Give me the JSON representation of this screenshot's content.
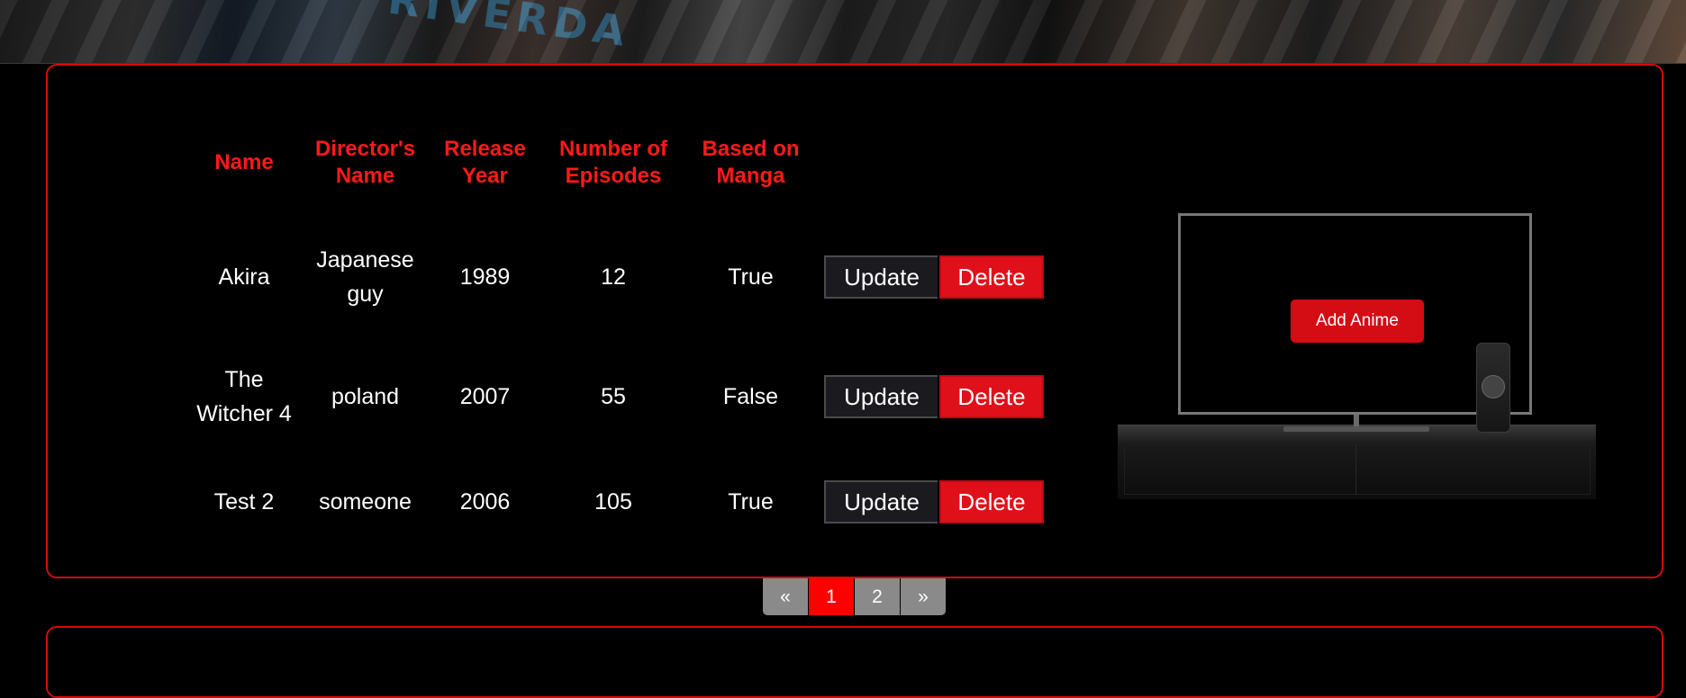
{
  "banner": {
    "word": "RIVERDA"
  },
  "table": {
    "headers": {
      "name": "Name",
      "director": "Director's Name",
      "year": "Release Year",
      "episodes": "Number of Episodes",
      "manga": "Based on Manga"
    },
    "rows": [
      {
        "name": "Akira",
        "director": "Japanese guy",
        "year": "1989",
        "episodes": "12",
        "manga": "True"
      },
      {
        "name": "The Witcher 4",
        "director": "poland",
        "year": "2007",
        "episodes": "55",
        "manga": "False"
      },
      {
        "name": "Test 2",
        "director": "someone",
        "year": "2006",
        "episodes": "105",
        "manga": "True"
      }
    ],
    "update_label": "Update",
    "delete_label": "Delete"
  },
  "add_button": "Add Anime",
  "pagination": {
    "prev": "«",
    "pages": [
      "1",
      "2"
    ],
    "next": "»",
    "active": "1"
  },
  "colors": {
    "accent": "#ff1a1a",
    "button_red": "#e0101a",
    "background": "#000000"
  }
}
